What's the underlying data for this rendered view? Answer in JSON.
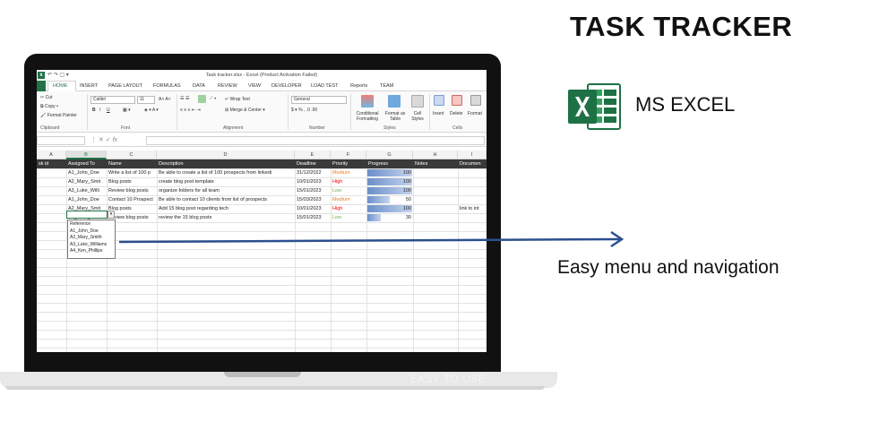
{
  "heading": "TASK TRACKER",
  "app_label": "MS EXCEL",
  "callout": "Easy menu and navigation",
  "base_caption": "EASY TO USE",
  "colors": {
    "excel_green": "#217346",
    "arrow": "#2b4f8e",
    "high": "#ff0000",
    "medium": "#e67e22",
    "low": "#70ad47"
  },
  "excel": {
    "window_title": "Task tracker.xlsx - Excel (Product Activation Failed)",
    "menu": [
      "HOME",
      "INSERT",
      "PAGE LAYOUT",
      "FORMULAS",
      "DATA",
      "REVIEW",
      "VIEW",
      "DEVELOPER",
      "LOAD TEST",
      "Reports",
      "TEAM"
    ],
    "ribbon": {
      "cut": "Cut",
      "copy": "Copy",
      "format_painter": "Format Painter",
      "clipboard": "Clipboard",
      "font_name": "Calibri",
      "font_size": "11",
      "font": "Font",
      "wrap_text": "Wrap Text",
      "merge_center": "Merge & Center",
      "alignment": "Alignment",
      "number_format": "General",
      "number": "Number",
      "conditional_formatting": "Conditional Formatting",
      "format_as_table": "Format as Table",
      "cell_styles": "Cell Styles",
      "styles": "Styles",
      "insert": "Insert",
      "delete": "Delete",
      "format": "Format",
      "cells": "Cells",
      "bold": "B",
      "italic": "I",
      "underline": "U",
      "fx": "fx"
    },
    "columns": [
      "A",
      "B",
      "C",
      "D",
      "E",
      "F",
      "G",
      "H",
      "I"
    ],
    "headers": [
      "sk id",
      "Assigned To",
      "Name",
      "Description",
      "Deadline",
      "Priority",
      "Progress",
      "Notes",
      "Documen"
    ],
    "rows": [
      {
        "assigned": "A1_John_Doe",
        "name": "Write a list of 100 p",
        "desc": "Be able to create a list of 100 prospects from linkedi",
        "deadline": "31/12/2022",
        "priority": "Medium",
        "progress": 100,
        "notes": "",
        "doc": ""
      },
      {
        "assigned": "A2_Mary_Smit",
        "name": "Blog posts",
        "desc": "create blog post template",
        "deadline": "10/01/2023",
        "priority": "High",
        "progress": 100,
        "notes": "",
        "doc": ""
      },
      {
        "assigned": "A3_Luke_Willi",
        "name": "Review blog posts",
        "desc": "organize folders for all team",
        "deadline": "15/01/2023",
        "priority": "Low",
        "progress": 100,
        "notes": "",
        "doc": ""
      },
      {
        "assigned": "A1_John_Doe",
        "name": "Contact 10 Prospect",
        "desc": "Be able to contact 10 clients from list of prospects",
        "deadline": "15/03/2023",
        "priority": "Medium",
        "progress": 50,
        "notes": "",
        "doc": ""
      },
      {
        "assigned": "A2_Mary_Smit",
        "name": "Blog posts",
        "desc": "Add 15 blog post regarding tech",
        "deadline": "10/01/2023",
        "priority": "High",
        "progress": 100,
        "notes": "",
        "doc": "link to int"
      },
      {
        "assigned": "A3_Luke_Willi",
        "name": "Review blog posts",
        "desc": "review the 15 blog posts",
        "deadline": "15/01/2023",
        "priority": "Low",
        "progress": 30,
        "notes": "",
        "doc": ""
      }
    ],
    "dropdown": [
      "Reference",
      "A1_John_Doe",
      "A2_Mary_Smith",
      "A3_Luke_Williams",
      "A4_Ken_Phillips"
    ]
  }
}
